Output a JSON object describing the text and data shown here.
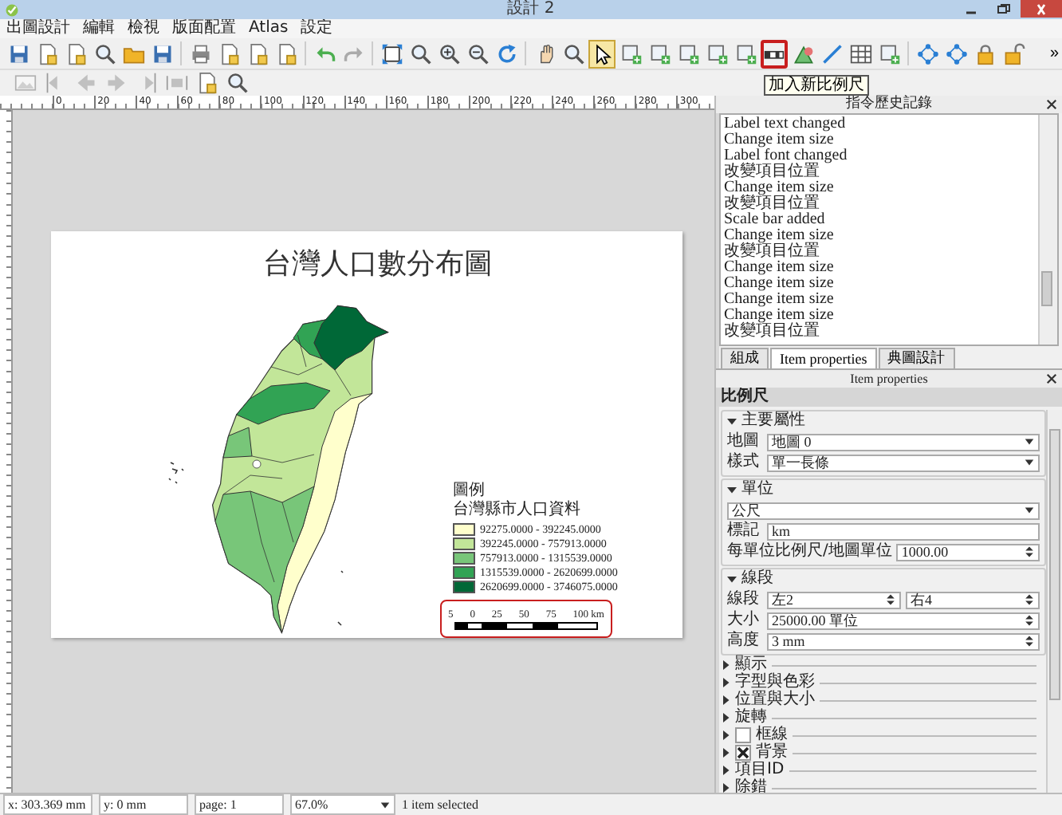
{
  "window": {
    "title": "設計 2"
  },
  "menu": [
    "出圖設計",
    "編輯",
    "檢視",
    "版面配置",
    "Atlas",
    "設定"
  ],
  "toolbar_1": [
    {
      "tools": [
        {
          "kind": "floppy",
          "selected": false,
          "highlighted": false
        },
        {
          "kind": "page",
          "selected": false,
          "highlighted": false
        },
        {
          "kind": "page",
          "selected": false,
          "highlighted": false
        },
        {
          "kind": "magnifier",
          "selected": false,
          "highlighted": false
        },
        {
          "kind": "folder",
          "selected": false,
          "highlighted": false
        },
        {
          "kind": "floppy",
          "selected": false,
          "highlighted": false
        }
      ]
    },
    {
      "tools": [
        {
          "kind": "printer",
          "selected": false,
          "highlighted": false
        },
        {
          "kind": "page",
          "selected": false,
          "highlighted": false
        },
        {
          "kind": "page",
          "selected": false,
          "highlighted": false
        },
        {
          "kind": "page",
          "selected": false,
          "highlighted": false
        }
      ]
    },
    {
      "tools": [
        {
          "kind": "undo",
          "selected": false,
          "highlighted": false
        },
        {
          "kind": "redo",
          "selected": false,
          "highlighted": false
        }
      ]
    },
    {
      "tools": [
        {
          "kind": "expand",
          "selected": false,
          "highlighted": false
        },
        {
          "kind": "magnifier",
          "selected": false,
          "highlighted": false
        },
        {
          "kind": "zoom-in",
          "selected": false,
          "highlighted": false
        },
        {
          "kind": "zoom-out",
          "selected": false,
          "highlighted": false
        },
        {
          "kind": "refresh",
          "selected": false,
          "highlighted": false
        }
      ]
    },
    {
      "tools": [
        {
          "kind": "hand",
          "selected": false,
          "highlighted": false
        },
        {
          "kind": "magnifier",
          "selected": false,
          "highlighted": false
        },
        {
          "kind": "cursor",
          "selected": true,
          "highlighted": false
        },
        {
          "kind": "frame",
          "selected": false,
          "highlighted": false
        },
        {
          "kind": "frame",
          "selected": false,
          "highlighted": false
        },
        {
          "kind": "frame",
          "selected": false,
          "highlighted": false
        },
        {
          "kind": "frame",
          "selected": false,
          "highlighted": false
        },
        {
          "kind": "frame",
          "selected": false,
          "highlighted": false
        },
        {
          "kind": "scale-bar",
          "selected": false,
          "highlighted": true
        },
        {
          "kind": "shapes",
          "selected": false,
          "highlighted": false
        },
        {
          "kind": "line",
          "selected": false,
          "highlighted": false
        },
        {
          "kind": "table",
          "selected": false,
          "highlighted": false
        },
        {
          "kind": "frame",
          "selected": false,
          "highlighted": false
        }
      ]
    },
    {
      "tools": [
        {
          "kind": "nodes",
          "selected": false,
          "highlighted": false
        },
        {
          "kind": "nodes",
          "selected": false,
          "highlighted": false
        },
        {
          "kind": "lock",
          "selected": false,
          "highlighted": false
        },
        {
          "kind": "unlock",
          "selected": false,
          "highlighted": false
        }
      ]
    }
  ],
  "toolbar_overflow": "»",
  "tooltip": "加入新比例尺",
  "toolbar_2": [
    {
      "kind": "image",
      "disabled": true
    },
    {
      "kind": "align-left",
      "disabled": true
    },
    {
      "kind": "arrow-left",
      "disabled": true
    },
    {
      "kind": "arrow-right",
      "disabled": true
    },
    {
      "kind": "align-right",
      "disabled": true
    },
    {
      "kind": "distribute",
      "disabled": true
    },
    {
      "kind": "page",
      "disabled": false
    },
    {
      "kind": "magnifier",
      "disabled": false
    }
  ],
  "ruler_labels": [
    "0",
    "20",
    "40",
    "60",
    "80",
    "100",
    "120",
    "140",
    "160",
    "180",
    "200",
    "220",
    "240",
    "260",
    "280",
    "300"
  ],
  "page": {
    "title": "台灣人口數分布圖",
    "legend": {
      "title": "圖例",
      "layer": "台灣縣市人口資料",
      "entries": [
        {
          "label": "92275.0000 - 392245.0000",
          "color": "#ffffcc"
        },
        {
          "label": "392245.0000 - 757913.0000",
          "color": "#c2e699"
        },
        {
          "label": "757913.0000 - 1315539.0000",
          "color": "#78c679"
        },
        {
          "label": "1315539.0000 - 2620699.0000",
          "color": "#31a354"
        },
        {
          "label": "2620699.0000 - 3746075.0000",
          "color": "#006837"
        }
      ]
    },
    "scale_bar": {
      "labels": [
        "5",
        "0",
        "25",
        "50",
        "75",
        "100 km"
      ],
      "highlighted": true
    }
  },
  "history": {
    "title": "指令歷史記錄",
    "entries": [
      "Label text changed",
      "Change item size",
      "Label font changed",
      "改變項目位置",
      "Change item size",
      "改變項目位置",
      "Scale bar added",
      "Change item size",
      "改變項目位置",
      "Change item size",
      "Change item size",
      "Change item size",
      "Change item size",
      "改變項目位置"
    ]
  },
  "properties": {
    "tabs": [
      {
        "label": "組成",
        "selected": false
      },
      {
        "label": "Item properties",
        "selected": true
      },
      {
        "label": "典圖設計",
        "selected": false
      }
    ],
    "title": "Item properties",
    "item_type": "比例尺",
    "groups": [
      {
        "title": "主要屬性",
        "expanded": true,
        "fields": [
          {
            "label": "地圖",
            "kind": "dropdown",
            "value": "地圖 0"
          },
          {
            "label": "樣式",
            "kind": "dropdown",
            "value": "單一長條"
          }
        ]
      },
      {
        "title": "單位",
        "expanded": true,
        "fields": [
          {
            "kind": "dropdown",
            "value": "公尺"
          },
          {
            "label": "標記",
            "kind": "text",
            "value": "km"
          },
          {
            "label": "每單位比例尺/地圖單位",
            "kind": "spin",
            "value": "1000.00"
          }
        ]
      },
      {
        "title": "線段",
        "expanded": true,
        "fields": [
          {
            "label": "線段",
            "kind": "spin_pair",
            "values": [
              "左2",
              "右4"
            ]
          },
          {
            "label": "大小",
            "kind": "spin",
            "value": "25000.00 單位"
          },
          {
            "label": "高度",
            "kind": "spin",
            "value": "3 mm"
          }
        ]
      },
      {
        "title": "顯示",
        "expanded": false
      },
      {
        "title": "字型與色彩",
        "expanded": false
      },
      {
        "title": "位置與大小",
        "expanded": false
      },
      {
        "title": "旋轉",
        "expanded": false
      },
      {
        "title": "框線",
        "expanded": false,
        "checked": false
      },
      {
        "title": "背景",
        "expanded": false,
        "checked": true
      },
      {
        "title": "項目ID",
        "expanded": false
      },
      {
        "title": "除錯",
        "expanded": false
      }
    ]
  },
  "status_bar": {
    "x": "x: 303.369 mm",
    "y": "y: 0 mm",
    "page": "page: 1",
    "zoom": "67.0%",
    "selection": "1 item selected"
  }
}
